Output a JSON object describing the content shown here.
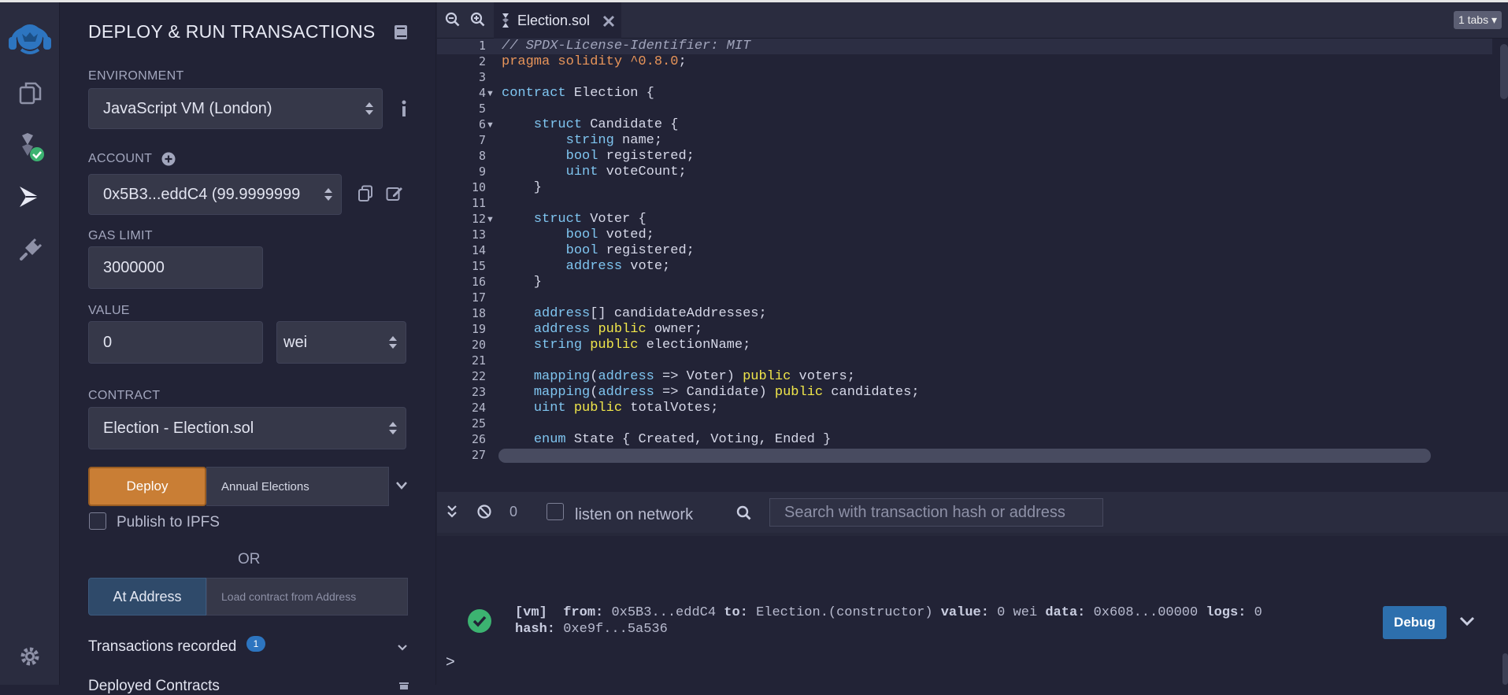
{
  "panel": {
    "title": "DEPLOY & RUN TRANSACTIONS",
    "environment": {
      "label": "ENVIRONMENT",
      "value": "JavaScript VM (London)"
    },
    "account": {
      "label": "ACCOUNT",
      "value": "0x5B3...eddC4 (99.9999999"
    },
    "gas_limit": {
      "label": "GAS LIMIT",
      "value": "3000000"
    },
    "value": {
      "label": "VALUE",
      "amount": "0",
      "unit": "wei"
    },
    "contract": {
      "label": "CONTRACT",
      "value": "Election - Election.sol"
    },
    "deploy_label": "Deploy",
    "deploy_arg": "Annual Elections",
    "publish_label": "Publish to IPFS",
    "or_label": "OR",
    "at_address_label": "At Address",
    "at_address_placeholder": "Load contract from Address",
    "transactions_recorded": {
      "label": "Transactions recorded",
      "count": "1"
    },
    "deployed_contracts_label": "Deployed Contracts"
  },
  "editor": {
    "tab_title": "Election.sol",
    "tabs_count": "1 tabs",
    "line_numbers": [
      "1",
      "2",
      "3",
      "4",
      "5",
      "6",
      "7",
      "8",
      "9",
      "10",
      "11",
      "12",
      "13",
      "14",
      "15",
      "16",
      "17",
      "18",
      "19",
      "20",
      "21",
      "22",
      "23",
      "24",
      "25",
      "26",
      "27"
    ],
    "lines": [
      "// SPDX-License-Identifier: MIT",
      "pragma solidity ^0.8.0;",
      "",
      "contract Election {",
      "",
      "    struct Candidate {",
      "        string name;",
      "        bool registered;",
      "        uint voteCount;",
      "    }",
      "",
      "    struct Voter {",
      "        bool voted;",
      "        bool registered;",
      "        address vote;",
      "    }",
      "",
      "    address[] candidateAddresses;",
      "    address public owner;",
      "    string public electionName;",
      "",
      "    mapping(address => Voter) public voters;",
      "    mapping(address => Candidate) public candidates;",
      "    uint public totalVotes;",
      "",
      "    enum State { Created, Voting, Ended }",
      ""
    ]
  },
  "terminal": {
    "pending_count": "0",
    "listen_label": "listen on network",
    "search_placeholder": "Search with transaction hash or address",
    "tx": {
      "tag": "[vm]",
      "from_label": "from:",
      "from": "0x5B3...eddC4",
      "to_label": "to:",
      "to": "Election.(constructor)",
      "value_label": "value:",
      "value": "0 wei",
      "data_label": "data:",
      "data": "0x608...00000",
      "logs_label": "logs:",
      "logs": "0",
      "hash_label": "hash:",
      "hash": "0xe9f...5a536"
    },
    "debug_label": "Debug",
    "prompt": ">"
  },
  "colors": {
    "accent_deploy": "#c97e35",
    "accent_blue": "#2d75c0",
    "success": "#3cb371"
  }
}
